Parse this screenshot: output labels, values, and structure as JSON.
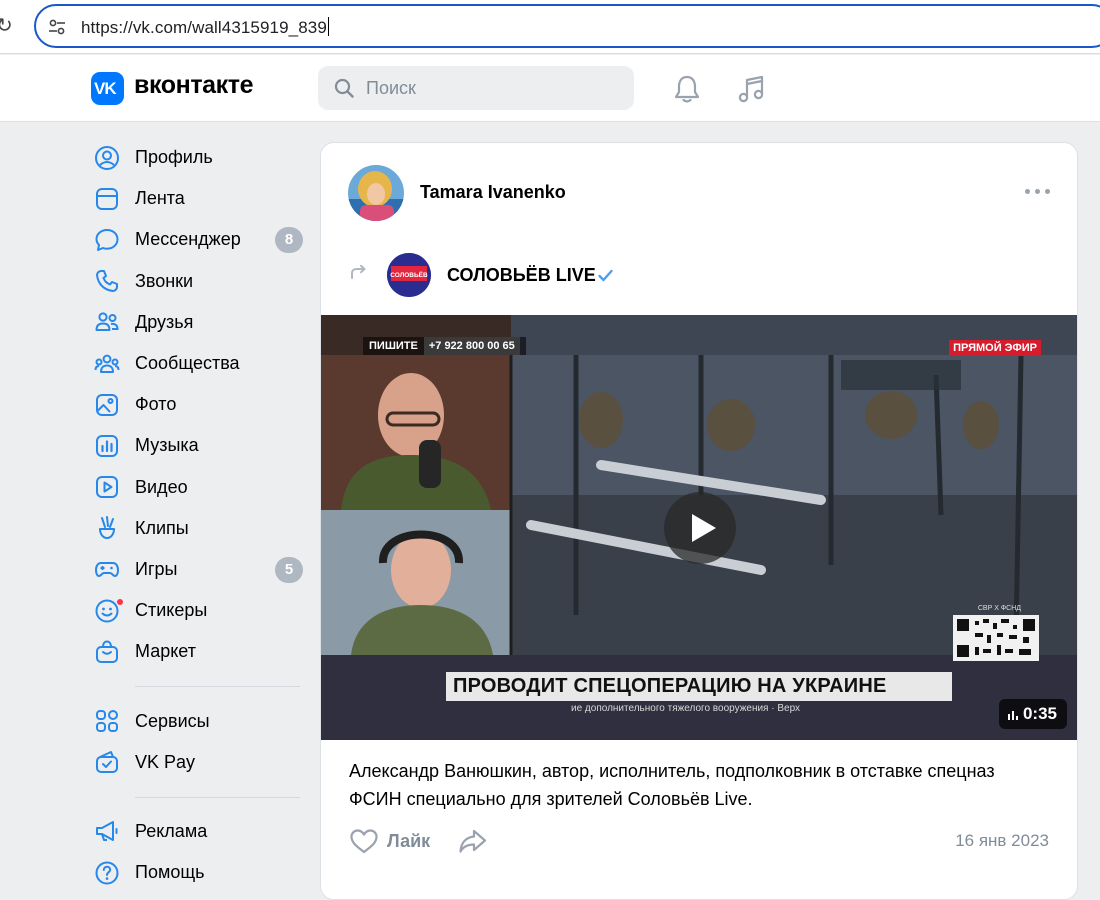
{
  "browser": {
    "url": "https://vk.com/wall4315919_839"
  },
  "header": {
    "logo_mark": "VK",
    "logo_text": "вконтакте",
    "search_placeholder": "Поиск",
    "icons": [
      "search-icon",
      "bell-icon",
      "music-icon"
    ]
  },
  "sidebar": {
    "items": [
      {
        "label": "Профиль",
        "icon": "profile-icon"
      },
      {
        "label": "Лента",
        "icon": "feed-icon"
      },
      {
        "label": "Мессенджер",
        "icon": "messenger-icon",
        "badge": "8"
      },
      {
        "label": "Звонки",
        "icon": "phone-icon"
      },
      {
        "label": "Друзья",
        "icon": "friends-icon"
      },
      {
        "label": "Сообщества",
        "icon": "communities-icon"
      },
      {
        "label": "Фото",
        "icon": "photo-icon"
      },
      {
        "label": "Музыка",
        "icon": "music-chart-icon"
      },
      {
        "label": "Видео",
        "icon": "video-icon"
      },
      {
        "label": "Клипы",
        "icon": "clips-icon"
      },
      {
        "label": "Игры",
        "icon": "games-icon",
        "badge": "5"
      },
      {
        "label": "Стикеры",
        "icon": "stickers-icon"
      },
      {
        "label": "Маркет",
        "icon": "market-icon"
      }
    ],
    "secondary": [
      {
        "label": "Сервисы",
        "icon": "services-icon"
      },
      {
        "label": "VK Pay",
        "icon": "vkpay-icon"
      }
    ],
    "tertiary": [
      {
        "label": "Реклама",
        "icon": "ads-icon"
      },
      {
        "label": "Помощь",
        "icon": "help-icon"
      }
    ]
  },
  "post": {
    "author": "Tamara Ivanenko",
    "repost_source": "СОЛОВЬЁВ LIVE",
    "group_avatar_text": "СОЛОВЬЁВ",
    "video": {
      "phone_label": "ПИШИТЕ",
      "phone_number": "+7 922 800 00 65",
      "live_label": "ПРЯМОЙ ЭФИР",
      "caption": "ПРОВОДИТ СПЕЦОПЕРАЦИЮ НА УКРАИНЕ",
      "ticker": "ие дополнительного тяжелого вооружения  ·  Верх",
      "qr_label": "СВР Х ФСНД",
      "duration": "0:35"
    },
    "text": "Александр Ванюшкин, автор, исполнитель, подполковник в отставке спецназ ФСИН специально для зрителей Соловьёв Live.",
    "like_label": "Лайк",
    "date": "16 янв 2023"
  },
  "colors": {
    "accent": "#0077ff",
    "page_bg": "#edeef0",
    "muted": "#818c99",
    "badge": "#aeb7c2",
    "live_red": "#d41c2c"
  }
}
